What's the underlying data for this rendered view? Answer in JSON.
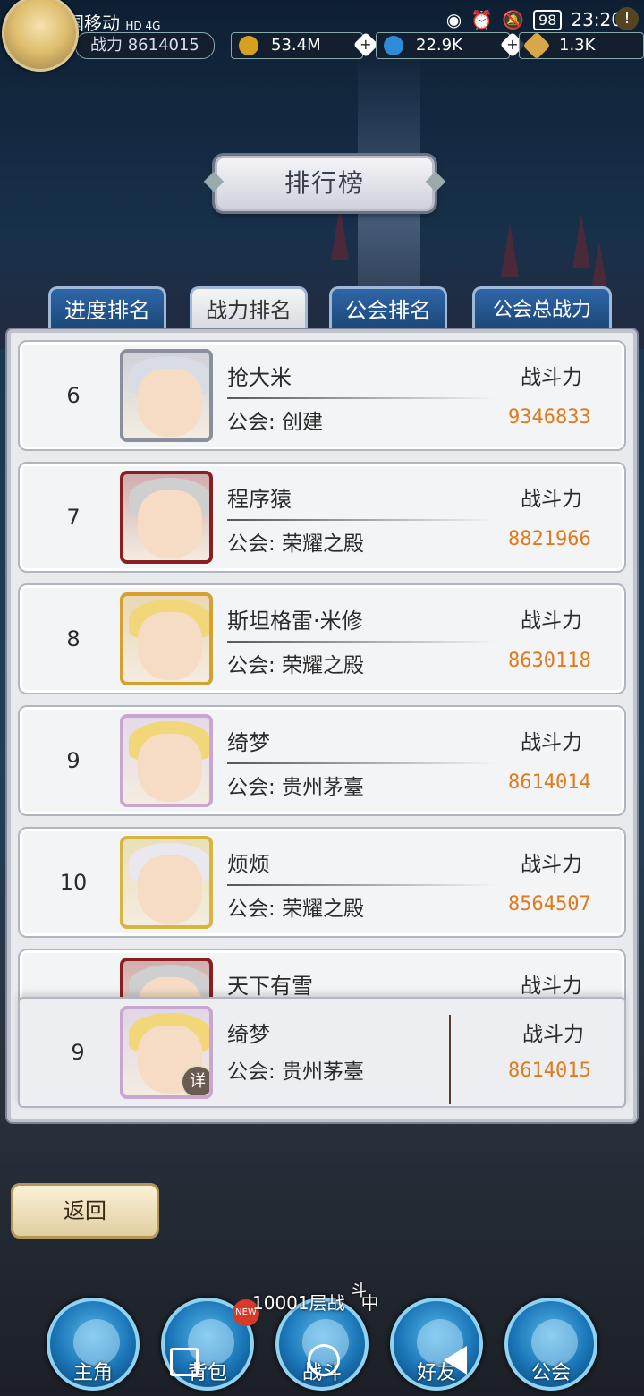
{
  "status_bar": {
    "carrier": "中国移动",
    "net_tags": "HD 4G",
    "battery": "98",
    "time": "23:20"
  },
  "resources": {
    "power_label": "战力 8614015",
    "gold": "53.4M",
    "gems": "22.9K",
    "stamina": "1.3K"
  },
  "title": "排行榜",
  "tabs": [
    {
      "label": "进度排名",
      "active": false
    },
    {
      "label": "战力排名",
      "active": true
    },
    {
      "label": "公会排名",
      "active": false
    },
    {
      "label": "公会总战力",
      "active": false
    }
  ],
  "power_column_label": "战斗力",
  "entries": [
    {
      "rank": "6",
      "name": "抢大米",
      "guild": "公会: 创建",
      "power": "9346833",
      "frame": "#8a8f9c",
      "hair": "#d8dce4"
    },
    {
      "rank": "7",
      "name": "程序猿",
      "guild": "公会: 荣耀之殿",
      "power": "8821966",
      "frame": "#8b1f1f",
      "hair": "#cfcfcf"
    },
    {
      "rank": "8",
      "name": "斯坦格雷·米修",
      "guild": "公会: 荣耀之殿",
      "power": "8630118",
      "frame": "#d6a030",
      "hair": "#f2d77a"
    },
    {
      "rank": "9",
      "name": "绮梦",
      "guild": "公会: 贵州茅臺",
      "power": "8614014",
      "frame": "#c9a6cf",
      "hair": "#f2d77a"
    },
    {
      "rank": "10",
      "name": "烦烦",
      "guild": "公会: 荣耀之殿",
      "power": "8564507",
      "frame": "#d8b540",
      "hair": "#e8e8ee"
    },
    {
      "rank": "",
      "name": "天下有雪",
      "guild": "",
      "power": "",
      "frame": "#8b1f1f",
      "hair": "#cfcfcf"
    }
  ],
  "self": {
    "rank": "9",
    "name": "绮梦",
    "guild": "公会: 贵州茅臺",
    "power": "8614015",
    "detail": "详",
    "frame": "#c9a6cf",
    "hair": "#f2d77a"
  },
  "back_button": "返回",
  "battle_status": "10001层战",
  "battle_status_sup": "斗",
  "battle_status_tail": "中",
  "new_badge": "NEW",
  "nav": [
    {
      "label": "主角"
    },
    {
      "label": "背包"
    },
    {
      "label": "战斗"
    },
    {
      "label": "好友"
    },
    {
      "label": "公会"
    }
  ],
  "colors": {
    "power_value": "#e07a1c",
    "tab_blue": "#2f66a8"
  }
}
